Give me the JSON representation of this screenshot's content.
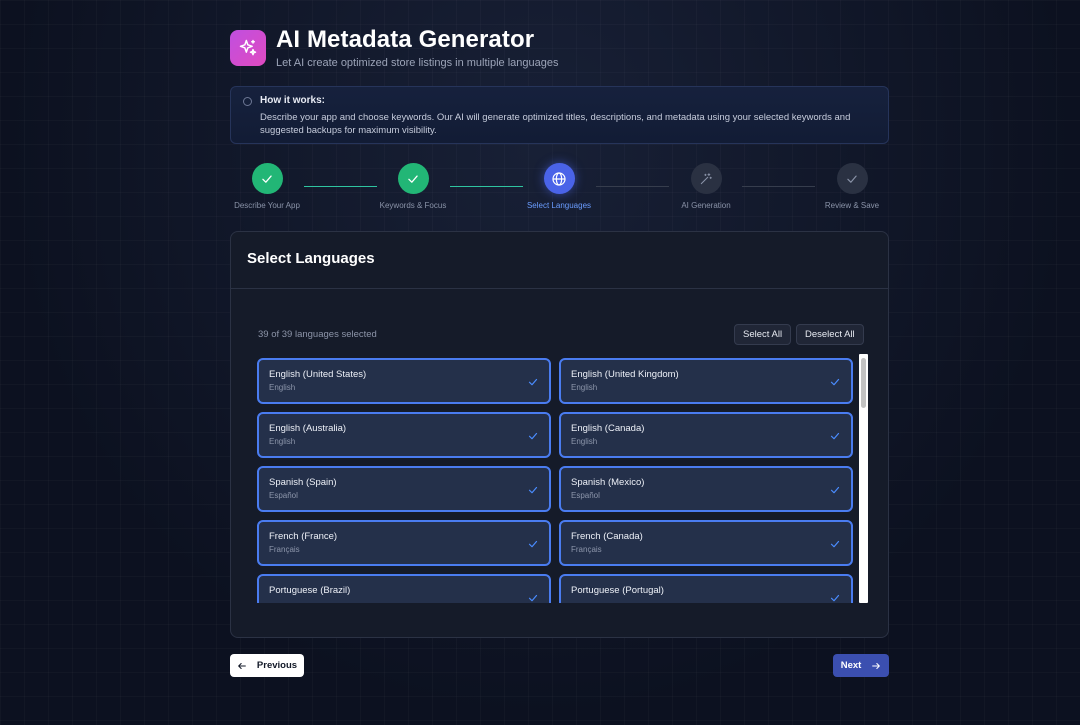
{
  "header": {
    "title": "AI Metadata Generator",
    "subtitle": "Let AI create optimized store listings in multiple languages",
    "logo_icon": "sparkles-icon"
  },
  "info": {
    "title": "How it works:",
    "text": "Describe your app and choose keywords. Our AI will generate optimized titles, descriptions, and metadata using your selected keywords and suggested backups for maximum visibility."
  },
  "steps": [
    {
      "label": "Describe Your App",
      "status": "done",
      "icon": "check-icon"
    },
    {
      "label": "Keywords & Focus",
      "status": "done",
      "icon": "check-icon"
    },
    {
      "label": "Select Languages",
      "status": "active",
      "icon": "globe-icon"
    },
    {
      "label": "AI Generation",
      "status": "todo",
      "icon": "magic-wand-icon"
    },
    {
      "label": "Review & Save",
      "status": "todo",
      "icon": "check-icon"
    }
  ],
  "panel": {
    "title": "Select Languages",
    "count_text": "39 of 39 languages selected",
    "select_all": "Select All",
    "deselect_all": "Deselect All"
  },
  "languages": [
    {
      "name": "English (United States)",
      "native": "English",
      "selected": true
    },
    {
      "name": "English (United Kingdom)",
      "native": "English",
      "selected": true
    },
    {
      "name": "English (Australia)",
      "native": "English",
      "selected": true
    },
    {
      "name": "English (Canada)",
      "native": "English",
      "selected": true
    },
    {
      "name": "Spanish (Spain)",
      "native": "Español",
      "selected": true
    },
    {
      "name": "Spanish (Mexico)",
      "native": "Español",
      "selected": true
    },
    {
      "name": "French (France)",
      "native": "Français",
      "selected": true
    },
    {
      "name": "French (Canada)",
      "native": "Français",
      "selected": true
    },
    {
      "name": "Portuguese (Brazil)",
      "native": "",
      "selected": true
    },
    {
      "name": "Portuguese (Portugal)",
      "native": "",
      "selected": true
    }
  ],
  "nav": {
    "previous": "Previous",
    "next": "Next"
  },
  "colors": {
    "accent": "#4a63e8",
    "success": "#22b676",
    "selected_border": "#4a7cf0",
    "logo_gradient_start": "#c04fe0",
    "logo_gradient_end": "#e04ac0"
  }
}
